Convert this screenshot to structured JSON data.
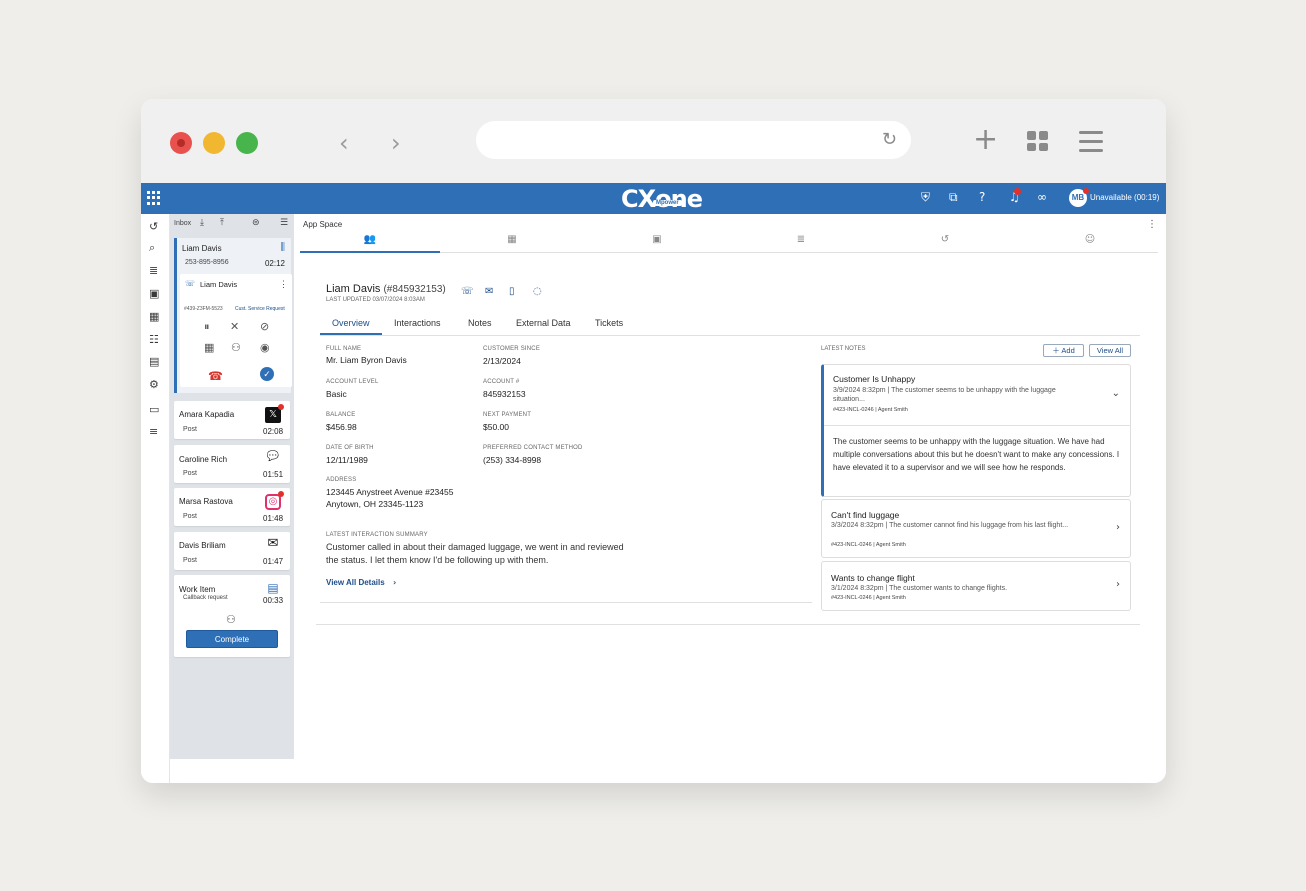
{
  "browser": {
    "nav_back": "‹",
    "nav_forward": "›",
    "reload": "↻",
    "new_tab": "+"
  },
  "topbar": {
    "logo": "CXone",
    "logo_sub": "Mpower",
    "status": "Unavailable (00:19)",
    "avatar_initials": "MB",
    "brand_color": "#2f6fb6"
  },
  "inbox": {
    "title": "Inbox",
    "active": {
      "name": "Liam Davis",
      "phone": "253-895-8956",
      "time": "02:12",
      "sub_name": "Liam Davis",
      "case_id": "#439-Z3FM-5523",
      "case_type": "Cust. Service Request"
    },
    "items": [
      {
        "name": "Amara Kapadia",
        "type": "Post",
        "time": "02:08",
        "icon": "x-icon"
      },
      {
        "name": "Caroline Rich",
        "type": "Post",
        "time": "01:51",
        "icon": "chat-icon"
      },
      {
        "name": "Marsa Rastova",
        "type": "Post",
        "time": "01:48",
        "icon": "instagram-icon"
      },
      {
        "name": "Davis Briliam",
        "type": "Post",
        "time": "01:47",
        "icon": "mail-icon"
      }
    ],
    "work_item": {
      "name": "Work Item",
      "type": "Callback request",
      "time": "00:33",
      "button": "Complete"
    }
  },
  "main": {
    "app_space": "App Space",
    "customer": {
      "name": "Liam Davis",
      "account_paren": "(#845932153)",
      "updated": "LAST UPDATED 03/07/2024  8:03AM"
    },
    "tabs": [
      "Overview",
      "Interactions",
      "Notes",
      "External Data",
      "Tickets"
    ],
    "fields": {
      "full_name_label": "FULL NAME",
      "full_name": "Mr. Liam Byron Davis",
      "customer_since_label": "CUSTOMER SINCE",
      "customer_since": "2/13/2024",
      "account_level_label": "ACCOUNT LEVEL",
      "account_level": "Basic",
      "account_num_label": "ACCOUNT #",
      "account_num": "845932153",
      "balance_label": "BALANCE",
      "balance": "$456.98",
      "next_payment_label": "NEXT PAYMENT",
      "next_payment": "$50.00",
      "dob_label": "DATE OF BIRTH",
      "dob": "12/11/1989",
      "preferred_label": "PREFERRED CONTACT METHOD",
      "preferred": "(253) 334-8998",
      "address_label": "ADDRESS",
      "address_line1": "123445 Anystreet Avenue #23455",
      "address_line2": "Anytown, OH 23345-1123"
    },
    "summary_label": "LATEST INTERACTION SUMMARY",
    "summary": "Customer called in about their damaged luggage, we went in and reviewed the status. I let them know I'd be following up with them.",
    "view_all_details": "View All Details"
  },
  "notes": {
    "label": "LATEST NOTES",
    "add": "Add",
    "view_all": "View All",
    "items": [
      {
        "title": "Customer Is Unhappy",
        "meta": "3/9/2024 8:32pm | The customer seems to be unhappy with the luggage situation...",
        "tag": "#423-INCL-0246 | Agent Smith",
        "body": "The customer seems to be unhappy with the luggage situation. We have had multiple conversations about this but he doesn't want to make any concessions. I have elevated it to a supervisor and we will see how he responds."
      },
      {
        "title": "Can't find luggage",
        "meta": "3/3/2024 8:32pm | The customer cannot find his luggage from his last flight...",
        "tag": "#423-INCL-0246 | Agent Smith"
      },
      {
        "title": "Wants to change flight",
        "meta": "3/1/2024 8:32pm | The customer wants to change flights.",
        "tag": "#423-INCL-0246 | Agent Smith"
      }
    ]
  }
}
